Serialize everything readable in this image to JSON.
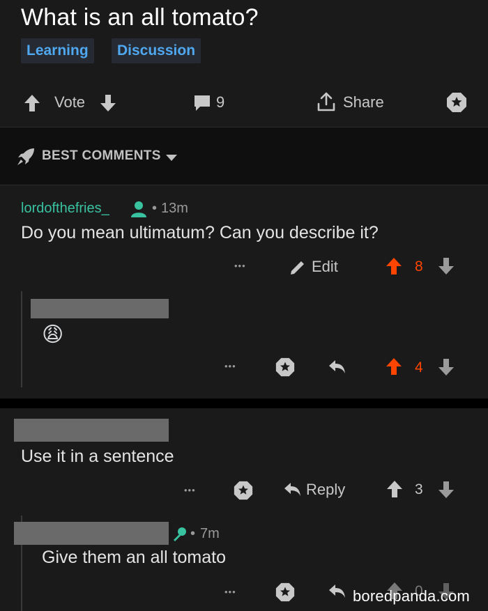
{
  "post": {
    "title": "What is an all tomato?",
    "flairs": [
      "Learning",
      "Discussion"
    ]
  },
  "action_bar": {
    "vote_label": "Vote",
    "comment_count": "9",
    "share_label": "Share"
  },
  "sort": {
    "label": "BEST COMMENTS"
  },
  "comments": [
    {
      "username": "lordofthefries_",
      "age": "13m",
      "body": "Do you mean ultimatum? Can you describe it?",
      "more": "•••",
      "edit_label": "Edit",
      "score": "8",
      "upvoted": true
    },
    {
      "username_redacted": true,
      "body_emoji": "😩",
      "more": "•••",
      "score": "4",
      "upvoted": true
    },
    {
      "username_redacted": true,
      "body": "Use it in a sentence",
      "more": "•••",
      "reply_label": "Reply",
      "score": "3"
    },
    {
      "username_redacted": true,
      "age": "7m",
      "body": "Give them an all tomato",
      "more": "•••",
      "score": "0"
    }
  ],
  "watermark": "boredpanda.com",
  "colors": {
    "background": "#1a1a1b",
    "accent_blue": "#4fa8f0",
    "username_green": "#39c2a0",
    "upvote_orange": "#ff4500"
  }
}
